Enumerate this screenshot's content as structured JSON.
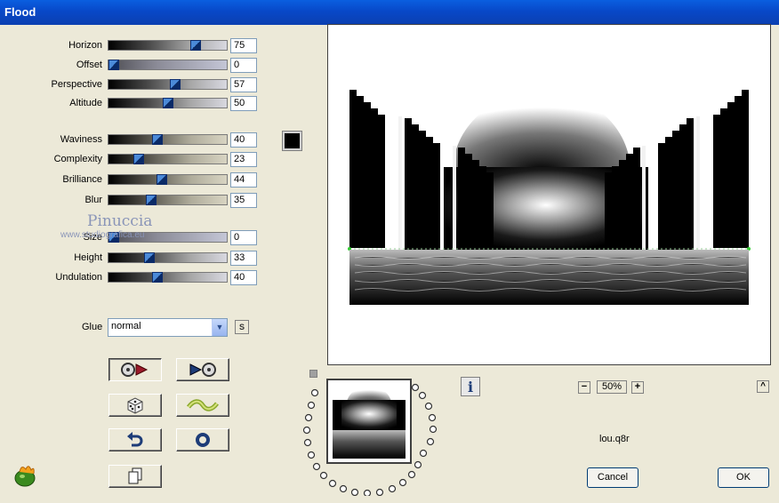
{
  "window": {
    "title": "Flood"
  },
  "sliders_group1": [
    {
      "label": "Horizon",
      "value": "75"
    },
    {
      "label": "Offset",
      "value": "0"
    },
    {
      "label": "Perspective",
      "value": "57"
    },
    {
      "label": "Altitude",
      "value": "50"
    }
  ],
  "sliders_group2": [
    {
      "label": "Waviness",
      "value": "40"
    },
    {
      "label": "Complexity",
      "value": "23"
    },
    {
      "label": "Brilliance",
      "value": "44"
    },
    {
      "label": "Blur",
      "value": "35"
    }
  ],
  "sliders_group3": [
    {
      "label": "Size",
      "value": "0"
    },
    {
      "label": "Height",
      "value": "33"
    },
    {
      "label": "Undulation",
      "value": "40"
    }
  ],
  "color_swatch": "#000000",
  "watermark": {
    "line1": "Pinuccia",
    "line2": "www.studiografica.eu"
  },
  "glue": {
    "label": "Glue",
    "selected": "normal",
    "side_button": "S"
  },
  "buttons": [
    {
      "name": "preset-save-button",
      "icon": "dice-arrow-right-icon"
    },
    {
      "name": "preset-load-button",
      "icon": "arrow-dice-icon"
    },
    {
      "name": "randomize-button",
      "icon": "dice-icon"
    },
    {
      "name": "wave-button",
      "icon": "wave-icon"
    },
    {
      "name": "undo-button",
      "icon": "undo-arrow-icon"
    },
    {
      "name": "reset-button",
      "icon": "ring-icon"
    },
    {
      "name": "copy-button",
      "icon": "copy-pages-icon"
    }
  ],
  "zoom": {
    "level": "50%",
    "minus": "−",
    "plus": "+"
  },
  "info_button_label": "i",
  "collapse_button_label": "^",
  "file_name": "lou.q8r",
  "cancel_label": "Cancel",
  "ok_label": "OK"
}
